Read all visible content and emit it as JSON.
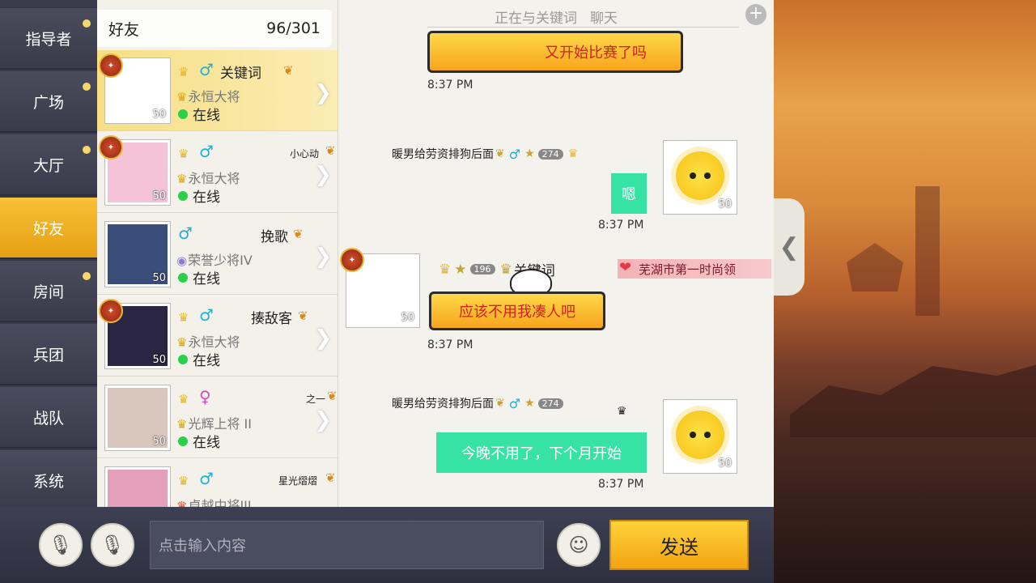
{
  "sidebar": {
    "items": [
      {
        "label": "指导者",
        "dot": true
      },
      {
        "label": "广场",
        "dot": true
      },
      {
        "label": "大厅",
        "dot": true
      },
      {
        "label": "好友",
        "dot": false,
        "active": true
      },
      {
        "label": "房间",
        "dot": true
      },
      {
        "label": "兵团",
        "dot": false
      },
      {
        "label": "战队",
        "dot": false
      },
      {
        "label": "系统",
        "dot": false
      }
    ]
  },
  "friends": {
    "title": "好友",
    "count": "96/301",
    "list": [
      {
        "name": "关键词",
        "rank": "永恒大将",
        "status": "在线",
        "level": "50",
        "gender": "♂"
      },
      {
        "name": "小心动",
        "rank": "永恒大将",
        "status": "在线",
        "level": "50",
        "gender": "♂"
      },
      {
        "name": "挽歌",
        "rank": "荣誉少将IV",
        "status": "在线",
        "level": "50",
        "gender": "♂"
      },
      {
        "name": "揍敌客",
        "rank": "永恒大将",
        "status": "在线",
        "level": "50",
        "gender": "♂"
      },
      {
        "name": "之一",
        "rank": "光辉上将 II",
        "status": "在线",
        "level": "50",
        "gender": "♀"
      },
      {
        "name": "星光熠熠",
        "rank": "卓越中将III",
        "status": "",
        "level": "",
        "gender": "♂"
      }
    ]
  },
  "chat": {
    "title_prefix": "正在与关键词",
    "title_suffix": "聊天",
    "messages": [
      {
        "text": "又开始比赛了吗",
        "time": "8:37 PM"
      },
      {
        "sender": "暖男给劳资排狗后面",
        "level": "274",
        "text": "嗯",
        "time": "8:37 PM",
        "avatar_level": "50"
      },
      {
        "sender": "关键词",
        "level": "196",
        "tag": "芜湖市第一时尚领",
        "text": "应该不用我凑人吧",
        "time": "8:37 PM",
        "avatar_level": "50"
      },
      {
        "sender": "暖男给劳资排狗后面",
        "level": "274",
        "text": "今晚不用了，下个月开始",
        "time": "8:37 PM",
        "avatar_level": "50"
      }
    ]
  },
  "input": {
    "placeholder": "点击输入内容"
  },
  "send_label": "发送"
}
